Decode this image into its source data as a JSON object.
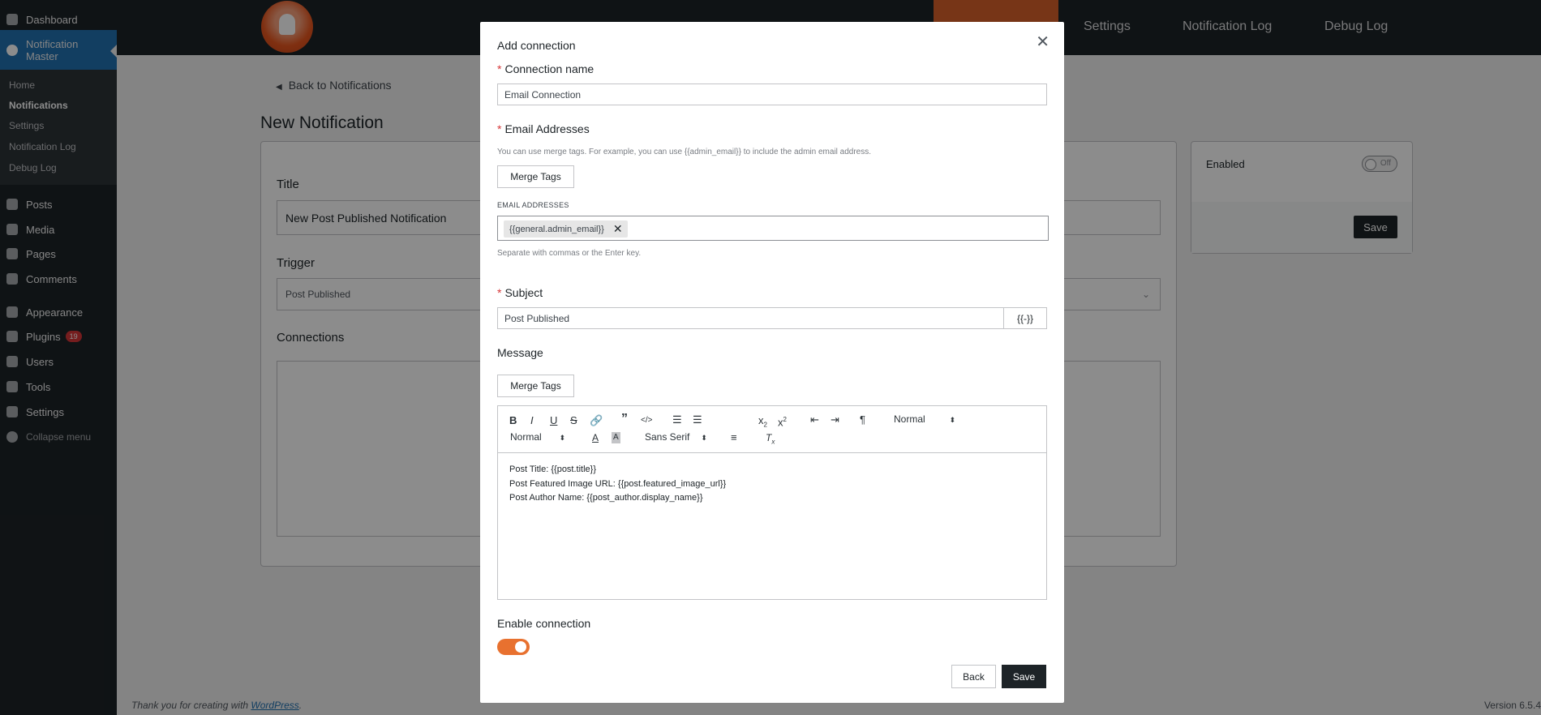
{
  "sidebar": {
    "dashboard": "Dashboard",
    "plugin_menu": "Notification Master",
    "submenu": [
      "Home",
      "Notifications",
      "Settings",
      "Notification Log",
      "Debug Log"
    ],
    "posts": "Posts",
    "media": "Media",
    "pages": "Pages",
    "comments": "Comments",
    "appearance": "Appearance",
    "plugins": "Plugins",
    "plugins_badge": "19",
    "users": "Users",
    "tools": "Tools",
    "settings": "Settings",
    "collapse": "Collapse menu"
  },
  "topnav": {
    "items": [
      "Settings",
      "Notification Log",
      "Debug Log"
    ]
  },
  "page": {
    "back_link": "Back to Notifications",
    "title": "New Notification",
    "title_label": "Title",
    "title_value": "New Post Published Notification",
    "trigger_label": "Trigger",
    "trigger_value": "Post Published",
    "connections_label": "Connections",
    "enabled_label": "Enabled",
    "enabled_toggle": "Off",
    "save_label": "Save"
  },
  "modal": {
    "title": "Add connection",
    "connection_name_label": "Connection name",
    "connection_name_value": "Email Connection",
    "email_addresses_label": "Email Addresses",
    "email_help": "You can use merge tags. For example, you can use {{admin_email}} to include the admin email address.",
    "merge_tags_label": "Merge Tags",
    "email_small_label": "EMAIL ADDRESSES",
    "email_chip": "{{general.admin_email}}",
    "email_separator_help": "Separate with commas or the Enter key.",
    "subject_label": "Subject",
    "subject_value": "Post Published",
    "subject_addon": "{{-}}",
    "message_label": "Message",
    "toolbar": {
      "header_select": "Normal",
      "size_select": "Normal",
      "font_select": "Sans Serif"
    },
    "message_lines": [
      "Post Title: {{post.title}}",
      "Post Featured Image URL: {{post.featured_image_url}}",
      "Post Author Name: {{post_author.display_name}}"
    ],
    "enable_connection_label": "Enable connection",
    "back_button": "Back",
    "save_button": "Save"
  },
  "footer": {
    "thanks_prefix": "Thank you for creating with ",
    "wordpress_link": "WordPress",
    "thanks_suffix": ".",
    "version": "Version 6.5.4"
  },
  "colors": {
    "accent": "#e8712f",
    "admin_bar": "#1d2327",
    "wp_blue": "#2271b1",
    "required": "#d63638"
  }
}
